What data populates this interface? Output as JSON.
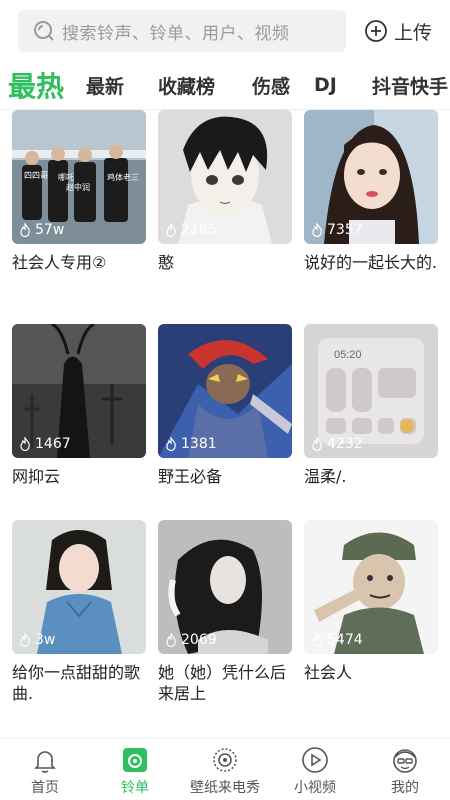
{
  "search": {
    "placeholder": "搜索铃声、铃单、用户、视频"
  },
  "upload": {
    "label": "上传"
  },
  "tabs": [
    {
      "label": "最热",
      "active": true
    },
    {
      "label": "最新"
    },
    {
      "label": "收藏榜"
    },
    {
      "label": "伤感"
    },
    {
      "label": "DJ"
    },
    {
      "label": "抖音快手"
    }
  ],
  "cards": [
    {
      "count": "57w",
      "title": "社会人专用②",
      "overlay_texts": [
        "四四哥",
        "哪吒",
        "赵中润",
        "鸡体老三"
      ]
    },
    {
      "count": "2185",
      "title": "憨"
    },
    {
      "count": "7357",
      "title": "说好的一起长大的."
    },
    {
      "count": "1467",
      "title": "网抑云"
    },
    {
      "count": "1381",
      "title": "野王必备"
    },
    {
      "count": "4232",
      "title": "温柔/.",
      "overlay_time": "05:20"
    },
    {
      "count": "3w",
      "title": "给你一点甜甜的歌曲."
    },
    {
      "count": "2069",
      "title": "她（她）凭什么后来居上"
    },
    {
      "count": "5474",
      "title": "社会人"
    }
  ],
  "nav": [
    {
      "label": "首页",
      "icon": "bell-icon"
    },
    {
      "label": "铃单",
      "icon": "playlist-icon",
      "active": true
    },
    {
      "label": "壁纸来电秀",
      "icon": "dial-icon"
    },
    {
      "label": "小视频",
      "icon": "play-icon"
    },
    {
      "label": "我的",
      "icon": "face-icon"
    }
  ],
  "colors": {
    "accent": "#2fbf5f",
    "text": "#222222",
    "muted": "#9a9a9a"
  }
}
